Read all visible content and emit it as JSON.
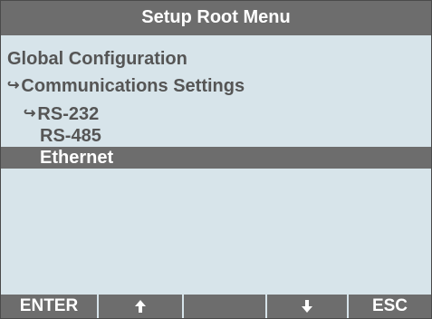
{
  "header": {
    "title": "Setup Root Menu"
  },
  "menu": {
    "items": [
      {
        "label": "Global Configuration",
        "arrow": "",
        "selected": false
      },
      {
        "label": "Communications Settings",
        "arrow": "↪",
        "selected": false
      },
      {
        "label": "RS-232",
        "arrow": "↪",
        "selected": false
      },
      {
        "label": "RS-485",
        "arrow": "",
        "selected": false
      },
      {
        "label": "Ethernet",
        "arrow": "",
        "selected": true
      }
    ]
  },
  "softkeys": {
    "enter_label": "ENTER",
    "up_icon": "up-arrow-icon",
    "blank_label": "",
    "down_icon": "down-arrow-icon",
    "esc_label": "ESC"
  },
  "colors": {
    "screen_background": "#d7e4ea",
    "bar_gray": "#6d6d6d",
    "text_gray": "#555555",
    "text_white": "#ffffff"
  }
}
